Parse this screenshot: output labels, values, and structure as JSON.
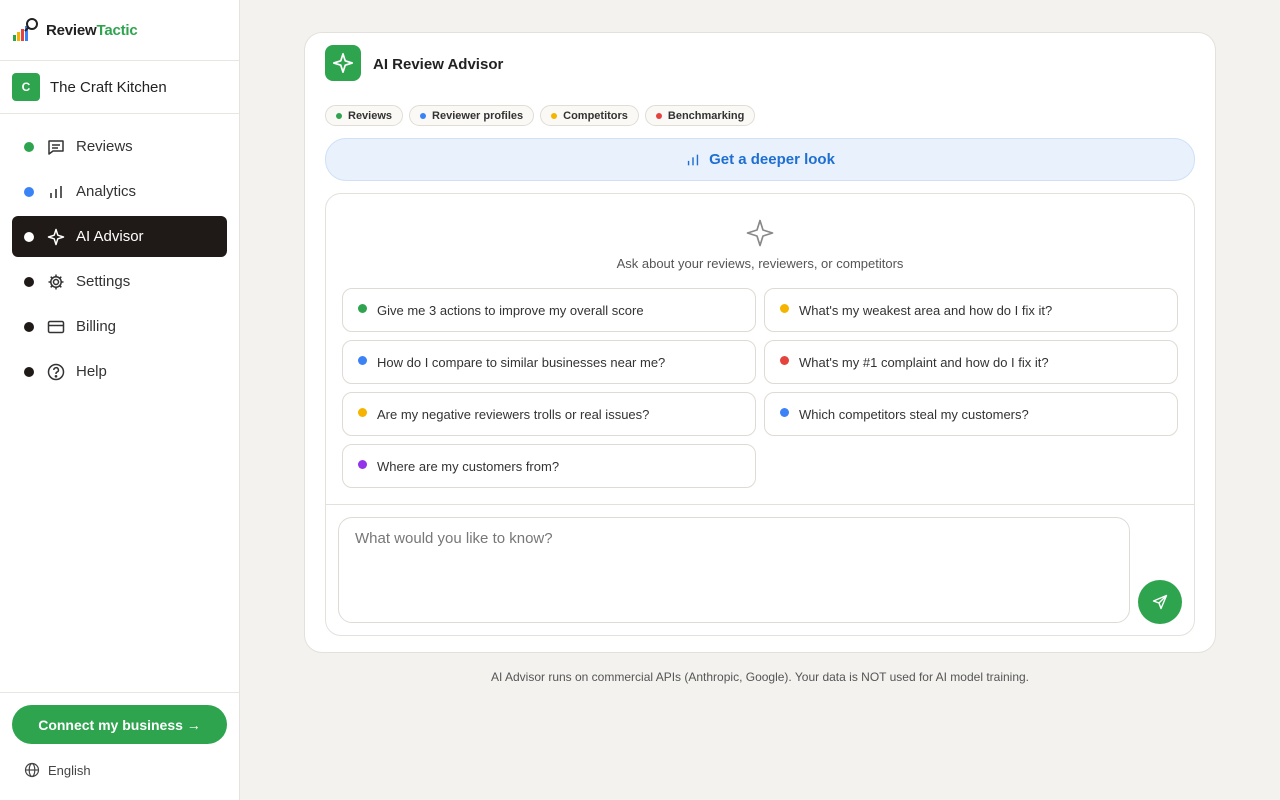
{
  "brand": {
    "name_part1": "Review",
    "name_part2": "Tactic",
    "accent_color": "#2ea44f"
  },
  "business": {
    "initial": "C",
    "name": "The Craft Kitchen"
  },
  "nav": [
    {
      "label": "Reviews",
      "icon": "chat-icon",
      "dot_color": "#2ea44f",
      "active": false
    },
    {
      "label": "Analytics",
      "icon": "bar-chart-icon",
      "dot_color": "#3b82f6",
      "active": false
    },
    {
      "label": "AI Advisor",
      "icon": "sparkle-icon",
      "dot_color": "#ffffff",
      "active": true
    },
    {
      "label": "Settings",
      "icon": "gear-icon",
      "dot_color": "#1f1a17",
      "active": false
    },
    {
      "label": "Billing",
      "icon": "credit-card-icon",
      "dot_color": "#1f1a17",
      "active": false
    },
    {
      "label": "Help",
      "icon": "help-circle-icon",
      "dot_color": "#1f1a17",
      "active": false
    }
  ],
  "connect_button": "Connect my business →",
  "language": "English",
  "advisor": {
    "title": "AI Review Advisor",
    "chips": [
      {
        "label": "Reviews",
        "color": "#2ea44f"
      },
      {
        "label": "Reviewer profiles",
        "color": "#3b82f6"
      },
      {
        "label": "Competitors",
        "color": "#f5b400"
      },
      {
        "label": "Benchmarking",
        "color": "#e5433d"
      }
    ],
    "deeper_look": "Get a deeper look",
    "ask_prompt": "Ask about your reviews, reviewers, or competitors",
    "suggestions": [
      {
        "text": "Give me 3 actions to improve my overall score",
        "color": "#2ea44f"
      },
      {
        "text": "What's my weakest area and how do I fix it?",
        "color": "#f5b400"
      },
      {
        "text": "How do I compare to similar businesses near me?",
        "color": "#3b82f6"
      },
      {
        "text": "What's my #1 complaint and how do I fix it?",
        "color": "#e5433d"
      },
      {
        "text": "Are my negative reviewers trolls or real issues?",
        "color": "#f5b400"
      },
      {
        "text": "Which competitors steal my customers?",
        "color": "#3b82f6"
      },
      {
        "text": "Where are my customers from?",
        "color": "#9333ea"
      }
    ],
    "input_placeholder": "What would you like to know?"
  },
  "footnote": "AI Advisor runs on commercial APIs (Anthropic, Google). Your data is NOT used for AI model training."
}
